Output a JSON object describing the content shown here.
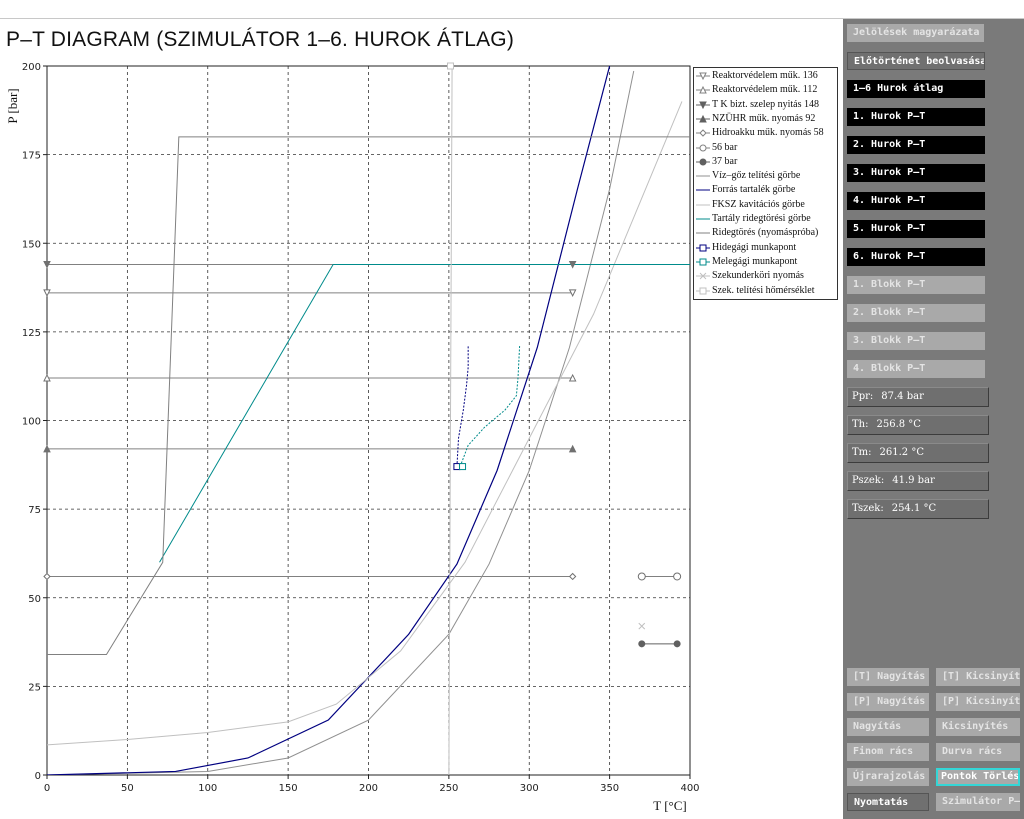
{
  "title": "P–T DIAGRAM (SZIMULÁTOR 1–6. HUROK ÁTLAG)",
  "axes": {
    "xlabel": "T [°C]",
    "ylabel": "P [bar]",
    "xticks": [
      "0",
      "50",
      "100",
      "150",
      "200",
      "250",
      "300",
      "350",
      "400"
    ],
    "yticks": [
      "0",
      "25",
      "50",
      "75",
      "100",
      "125",
      "150",
      "175",
      "200"
    ]
  },
  "legend": [
    {
      "label": "Reaktorvédelem műk. 136",
      "marker": "triangle-down",
      "color": "#808080"
    },
    {
      "label": "Reaktorvédelem műk. 112",
      "marker": "triangle-up-open",
      "color": "#808080"
    },
    {
      "label": "T K bizt. szelep nyitás 148",
      "marker": "triangle-down-filled",
      "color": "#606060"
    },
    {
      "label": "NZÜHR műk. nyomás 92",
      "marker": "triangle-up-filled",
      "color": "#606060"
    },
    {
      "label": "Hidroakku műk. nyomás 58",
      "marker": "diamond-open",
      "color": "#808080"
    },
    {
      "label": "56 bar",
      "marker": "circle-open",
      "color": "#808080"
    },
    {
      "label": "37 bar",
      "marker": "circle-filled",
      "color": "#606060"
    },
    {
      "label": "Víz–gőz telítési görbe",
      "marker": "line",
      "color": "#909090"
    },
    {
      "label": "Forrás tartalék görbe",
      "marker": "line",
      "color": "#000080"
    },
    {
      "label": "FKSZ kavitációs görbe",
      "marker": "line",
      "color": "#c0c0c0"
    },
    {
      "label": "Tartály ridegtörési görbe",
      "marker": "line",
      "color": "#008b8b"
    },
    {
      "label": "Ridegtörés (nyomáspróba)",
      "marker": "line",
      "color": "#808080"
    },
    {
      "label": "Hidegági munkapont",
      "marker": "square-open",
      "color": "#000080"
    },
    {
      "label": "Melegági munkapont",
      "marker": "square-open",
      "color": "#008b8b"
    },
    {
      "label": "Szekunderköri nyomás",
      "marker": "x",
      "color": "#c0c0c0"
    },
    {
      "label": "Szek. telítési hőmérséklet",
      "marker": "square-open",
      "color": "#c0c0c0"
    }
  ],
  "sidebar": {
    "buttons": [
      {
        "label": "Jelölések magyarázata",
        "style": "gray"
      },
      {
        "label": "Előtörténet beolvasása",
        "style": "dark"
      },
      {
        "label": "1–6 Hurok átlag",
        "style": "black"
      },
      {
        "label": "1. Hurok P–T",
        "style": "black"
      },
      {
        "label": "2. Hurok P–T",
        "style": "black"
      },
      {
        "label": "3. Hurok P–T",
        "style": "black"
      },
      {
        "label": "4. Hurok P–T",
        "style": "black"
      },
      {
        "label": "5. Hurok P–T",
        "style": "black"
      },
      {
        "label": "6. Hurok P–T",
        "style": "black"
      },
      {
        "label": "1. Blokk P–T",
        "style": "gray"
      },
      {
        "label": "2. Blokk P–T",
        "style": "gray"
      },
      {
        "label": "3. Blokk P–T",
        "style": "gray"
      },
      {
        "label": "4. Blokk P–T",
        "style": "gray"
      }
    ],
    "readouts": [
      {
        "label": "Ppr:",
        "value": "87.4 bar"
      },
      {
        "label": "Th:",
        "value": "256.8 °C"
      },
      {
        "label": "Tm:",
        "value": "261.2 °C"
      },
      {
        "label": "Pszek:",
        "value": "41.9 bar"
      },
      {
        "label": "Tszek:",
        "value": "254.1 °C"
      }
    ],
    "controls": [
      {
        "label": "[T] Nagyítás",
        "style": "gray"
      },
      {
        "label": "[T] Kicsinyítés",
        "style": "gray"
      },
      {
        "label": "[P] Nagyítás",
        "style": "gray"
      },
      {
        "label": "[P] Kicsinyítés",
        "style": "gray"
      },
      {
        "label": "Nagyítás",
        "style": "gray"
      },
      {
        "label": "Kicsinyítés",
        "style": "gray"
      },
      {
        "label": "Finom rács",
        "style": "gray"
      },
      {
        "label": "Durva rács",
        "style": "gray"
      },
      {
        "label": "Újrarajzolás",
        "style": "gray"
      },
      {
        "label": "Pontok Törlése",
        "style": "hl"
      },
      {
        "label": "Nyomtatás",
        "style": "dark"
      },
      {
        "label": "Szimulátor P–T",
        "style": "gray"
      }
    ]
  },
  "colors": {
    "sidebar_bg": "#7a7a7a",
    "button_black": "#000000",
    "button_gray": "#a9a9a9",
    "highlight_border": "#34d6d6",
    "grid": "#333333"
  },
  "chart_data": {
    "type": "line",
    "xlabel": "T [°C]",
    "ylabel": "P [bar]",
    "xlim": [
      0,
      400
    ],
    "ylim": [
      0,
      200
    ],
    "grid": true,
    "legend_position": "top-right",
    "series": [
      {
        "name": "Reaktorvédelem műk. 136",
        "x": [
          0,
          327
        ],
        "y": [
          136,
          136
        ],
        "color": "#808080"
      },
      {
        "name": "Reaktorvédelem műk. 112",
        "x": [
          0,
          327
        ],
        "y": [
          112,
          112
        ],
        "color": "#808080"
      },
      {
        "name": "T K bizt. szelep nyitás 148",
        "x": [
          0,
          327
        ],
        "y": [
          144,
          144
        ],
        "color": "#808080"
      },
      {
        "name": "NZÜHR műk. nyomás 92",
        "x": [
          0,
          327
        ],
        "y": [
          92,
          92
        ],
        "color": "#808080"
      },
      {
        "name": "Hidroakku műk. nyomás 58",
        "x": [
          0,
          327
        ],
        "y": [
          56,
          56
        ],
        "color": "#808080"
      },
      {
        "name": "56 bar",
        "x": [
          370,
          392
        ],
        "y": [
          56,
          56
        ],
        "color": "#808080"
      },
      {
        "name": "37 bar",
        "x": [
          370,
          392
        ],
        "y": [
          37,
          37
        ],
        "color": "#606060"
      },
      {
        "name": "Víz–gőz telítési görbe",
        "x": [
          0,
          100,
          150,
          200,
          250,
          275,
          300,
          325,
          350,
          365
        ],
        "y": [
          0,
          1,
          4.8,
          15.5,
          39.7,
          59.5,
          85.9,
          120.6,
          165.3,
          198.6
        ],
        "color": "#909090"
      },
      {
        "name": "Forrás tartalék görbe",
        "x": [
          0,
          80,
          125,
          175,
          225,
          255,
          280,
          305,
          330,
          350
        ],
        "y": [
          0,
          1,
          4.8,
          15.5,
          39.7,
          59.5,
          85.9,
          120.6,
          165.3,
          200
        ],
        "color": "#000080"
      },
      {
        "name": "FKSZ kavitációs görbe",
        "x": [
          0,
          50,
          100,
          150,
          180,
          220,
          260,
          300,
          340,
          395
        ],
        "y": [
          8.5,
          10,
          12,
          15,
          20,
          35,
          60,
          95,
          130,
          190
        ],
        "color": "#c0c0c0"
      },
      {
        "name": "Tartály ridegtörési görbe",
        "x": [
          70,
          178,
          400
        ],
        "y": [
          60,
          144,
          144
        ],
        "color": "#008b8b"
      },
      {
        "name": "Ridegtörés (nyomáspróba)",
        "x": [
          0,
          37,
          72,
          82,
          400
        ],
        "y": [
          34,
          34,
          60,
          180,
          180
        ],
        "color": "#808080"
      },
      {
        "name": "Hidegági munkapont",
        "x": [
          255,
          256,
          259,
          261,
          262,
          262
        ],
        "y": [
          87,
          95,
          103,
          110,
          115,
          121
        ],
        "color": "#000080"
      },
      {
        "name": "Melegági munkapont",
        "x": [
          257,
          262,
          272,
          285,
          292,
          293,
          294
        ],
        "y": [
          87,
          93,
          98,
          103,
          107,
          112,
          121
        ],
        "color": "#008b8b"
      },
      {
        "name": "Szekunderköri nyomás",
        "x": [
          370
        ],
        "y": [
          42
        ],
        "color": "#c0c0c0"
      },
      {
        "name": "Szek. telítési hőmérséklet",
        "x": [
          250,
          252
        ],
        "y": [
          0,
          200
        ],
        "color": "#c0c0c0"
      }
    ]
  }
}
